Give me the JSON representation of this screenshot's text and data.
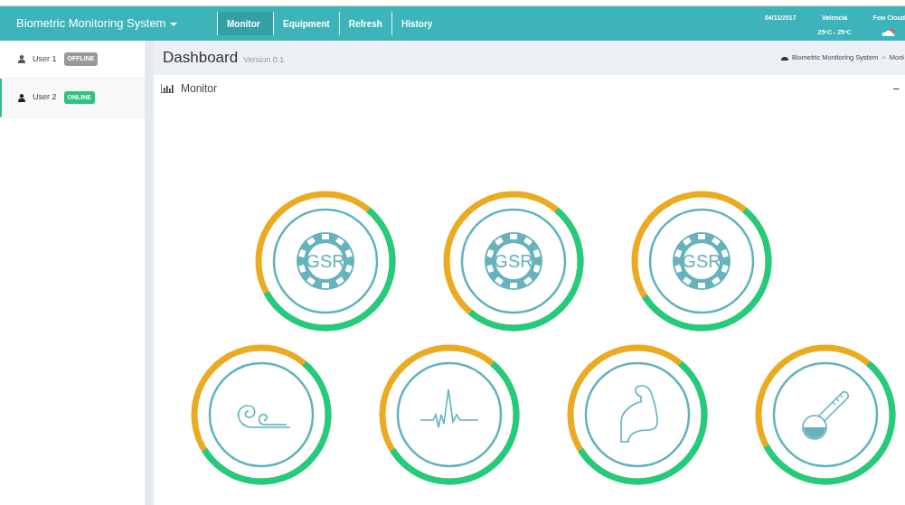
{
  "navbar": {
    "brand": "Biometric Monitoring System",
    "tabs": [
      {
        "label": "Monitor",
        "selected": true
      },
      {
        "label": "Equipment",
        "selected": false
      },
      {
        "label": "Refresh",
        "selected": false
      },
      {
        "label": "History",
        "selected": false
      }
    ],
    "date": "04/11/2017",
    "city": "Valencia",
    "temperature": "25ºC - 25ºC",
    "weather": "Few Cloud"
  },
  "sidebar": {
    "users": [
      {
        "name": "User 1",
        "status": "OFFLINE",
        "online": false,
        "selected": false
      },
      {
        "name": "User 2",
        "status": "ONLINE",
        "online": true,
        "selected": true
      }
    ]
  },
  "header": {
    "title": "Dashboard",
    "version": "Version 0.1",
    "breadcrumb": [
      "Biometric Monitoring System",
      "Moni"
    ],
    "separator": ">"
  },
  "panel": {
    "title": "Monitor",
    "collapse": "−",
    "gauge_rows": [
      [
        {
          "kind": "gsr",
          "label": "GSR",
          "level": 0.56
        },
        {
          "kind": "gsr",
          "label": "GSR",
          "level": 0.5
        },
        {
          "kind": "gsr",
          "label": "GSR",
          "level": 0.55
        }
      ],
      [
        {
          "kind": "wind",
          "level": 0.55
        },
        {
          "kind": "pulse",
          "level": 0.55
        },
        {
          "kind": "muscle",
          "level": 0.55
        },
        {
          "kind": "temperature",
          "level": 0.56
        }
      ]
    ]
  }
}
